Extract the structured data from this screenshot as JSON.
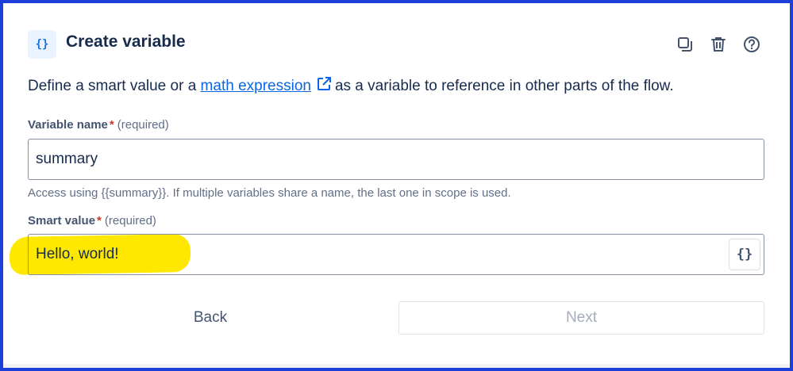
{
  "header": {
    "icon": "braces-icon",
    "icon_glyph": "{}",
    "title": "Create variable",
    "actions": [
      {
        "icon": "duplicate-icon"
      },
      {
        "icon": "trash-icon"
      },
      {
        "icon": "help-icon"
      }
    ]
  },
  "description": {
    "before": "Define a smart value or a ",
    "link": "math expression",
    "after": "as a variable to reference in other parts of the flow."
  },
  "variable_name": {
    "label": "Variable name",
    "required_star": "*",
    "required_text": "(required)",
    "value": "summary",
    "helper": "Access using {{summary}}. If multiple variables share a name, the last one in scope is used."
  },
  "smart_value": {
    "label": "Smart value",
    "required_star": "*",
    "required_text": "(required)",
    "value": "Hello, world!",
    "button_glyph": "{}",
    "highlight_color": "#ffe800"
  },
  "footer": {
    "back_label": "Back",
    "next_label": "Next"
  },
  "colors": {
    "frame_border": "#1c3fd9",
    "link": "#0c66e4",
    "required": "#c9372c"
  }
}
